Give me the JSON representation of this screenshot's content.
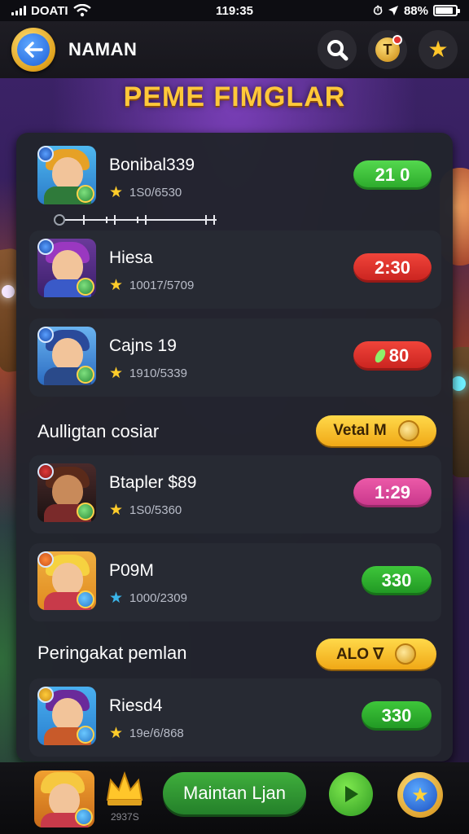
{
  "status_bar": {
    "carrier": "DOATI",
    "time": "119:35",
    "battery": "88%",
    "battery_level": 0.88
  },
  "header": {
    "title": "NAMAN",
    "back_icon": "back-arrow-icon",
    "search_icon": "search-icon",
    "token_icon": "token-icon",
    "star_icon": "star-icon",
    "token_label": "T"
  },
  "game_title": "PEME FIMGLAR",
  "players": [
    {
      "name": "Bonibal339",
      "stat": "1S0/6530",
      "badge": "21 0",
      "badge_color": "#3cbf3a",
      "progress": 0.0
    },
    {
      "name": "Hiesa",
      "stat": "10017/5709",
      "badge": "2:30",
      "badge_color": "#d8302a"
    },
    {
      "name": "Cajns 19",
      "stat": "1910/5339",
      "badge": "80",
      "badge_color": "#d8302a"
    }
  ],
  "section1": {
    "heading": "Aulligtan cosiar",
    "button": "Vetal M"
  },
  "players2": [
    {
      "name": "Btapler $89",
      "stat": "1S0/5360",
      "badge": "1:29",
      "badge_color": "#d9409a"
    },
    {
      "name": "P09M",
      "stat": "1000/2309",
      "badge": "330",
      "badge_color": "#2ea82e"
    }
  ],
  "section2": {
    "heading": "Peringakat pemlan",
    "button": "ALO ∇"
  },
  "players3": [
    {
      "name": "Riesd4",
      "stat": "19e/6/868",
      "badge": "330",
      "badge_color": "#2ea82e"
    }
  ],
  "bottom_bar": {
    "score": "2937S",
    "play_text": "Maintan Ljan",
    "play_icon": "play-icon",
    "star_icon": "star-icon"
  }
}
